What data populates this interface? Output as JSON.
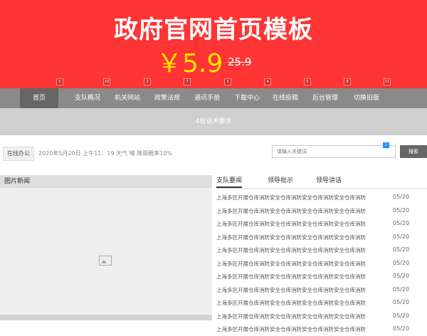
{
  "banner": {
    "title": "政府官网首页模板",
    "price": "￥5.9",
    "old_price": "25.9"
  },
  "nav": {
    "items": [
      "首页",
      "支队概况",
      "机关网站",
      "政策法规",
      "通讯手册",
      "下载中心",
      "在线投稿",
      "后台管理",
      "切换旧版"
    ],
    "badges": [
      "0",
      "10",
      "2",
      "7",
      "3",
      "4",
      "6",
      "8",
      "11"
    ]
  },
  "band": {
    "text": "4包话术要求"
  },
  "info": {
    "location": "在线办公",
    "datetime": "2020年5月20日 上午11：19  天气 晴 降雨概率10%",
    "search_placeholder": "请输入关键词",
    "search_button": "搜索",
    "search_badge": "1"
  },
  "photo": {
    "title": "图片新闻"
  },
  "tabs": [
    "支队要闻",
    "领导批示",
    "领导讲话"
  ],
  "news": {
    "title": "上海多区开展仓库消防安全仓库消防安全仓库消防安全仓库消防",
    "date": "05/20",
    "rows": 11
  },
  "colors": {
    "banner": "#ff3434",
    "price": "#ffe600",
    "nav": "#8a8a8a",
    "nav_active": "#666666",
    "band": "#cfcfcf"
  }
}
